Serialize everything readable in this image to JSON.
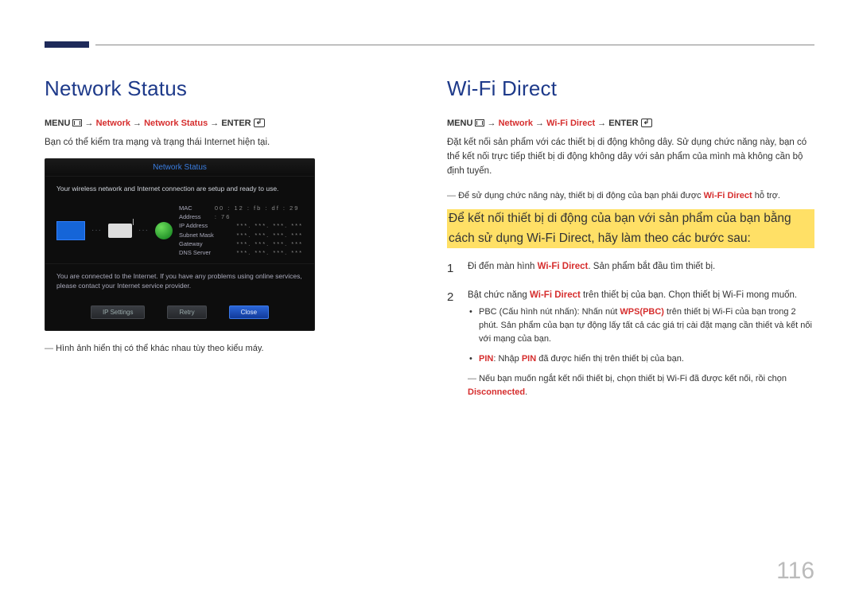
{
  "page_number": "116",
  "left": {
    "heading": "Network Status",
    "menu_prefix": "MENU",
    "menu_seg1": "Network",
    "menu_seg2": "Network Status",
    "menu_suffix": "ENTER",
    "body1": "Bạn có thể kiểm tra mạng và trạng thái Internet hiện tại.",
    "screenshot": {
      "title": "Network Status",
      "line1": "Your wireless network and Internet connection are setup and ready to use.",
      "info": {
        "mac_label": "MAC Address",
        "mac_val": "00 : 12 : fb : df : 29 : 76",
        "ip_label": "IP Address",
        "ip_val": "***.  ***.  ***.  ***",
        "subnet_label": "Subnet Mask",
        "subnet_val": "***.  ***.  ***.  ***",
        "gw_label": "Gateway",
        "gw_val": "***.  ***.  ***.  ***",
        "dns_label": "DNS Server",
        "dns_val": "***.  ***.  ***.  ***"
      },
      "line2": "You are connected to the Internet. If you have any problems using online services, please contact your Internet service provider.",
      "btn_ip": "IP Settings",
      "btn_retry": "Retry",
      "btn_close": "Close"
    },
    "note": "Hình ảnh hiển thị có thể khác nhau tùy theo kiểu máy."
  },
  "right": {
    "heading": "Wi-Fi Direct",
    "menu_prefix": "MENU",
    "menu_seg1": "Network",
    "menu_seg2": "Wi-Fi Direct",
    "menu_suffix": "ENTER",
    "body1": "Đặt kết nối sản phẩm với các thiết bị di động không dây. Sử dụng chức năng này, bạn có thể kết nối trực tiếp thiết bị di động không dây với sản phẩm của mình mà không cần bộ định tuyến.",
    "note1_pre": "Để sử dụng chức năng này, thiết bị di động của bạn phải được ",
    "note1_hl": "Wi-Fi Direct",
    "note1_post": " hỗ trợ.",
    "highlight": "Để kết nối thiết bị di động của bạn với sản phẩm của bạn bằng cách sử dụng  Wi-Fi Direct, hãy làm theo các bước sau:",
    "step1_pre": "Đi đến màn hình ",
    "step1_hl": "Wi-Fi Direct",
    "step1_post": ". Sản phẩm bắt đầu tìm thiết bị.",
    "step2_pre": "Bật chức năng ",
    "step2_hl": "Wi-Fi Direct",
    "step2_post": " trên thiết bị của bạn. Chọn thiết bị Wi-Fi mong muốn.",
    "bullet1_pre": "PBC (Cấu hình nút nhấn): Nhấn nút ",
    "bullet1_hl": "WPS(PBC)",
    "bullet1_post": " trên thiết bị Wi-Fi của bạn trong 2 phút. Sản phẩm của bạn tự động lấy tất cả các giá trị cài đặt mạng cần thiết và kết nối với mạng của bạn.",
    "bullet2_hl1": "PIN",
    "bullet2_mid": ": Nhập ",
    "bullet2_hl2": "PIN",
    "bullet2_post": " đã được hiển thị trên thiết bị của bạn.",
    "note2_pre": "Nếu bạn muốn ngắt kết nối thiết bị, chọn thiết bị Wi-Fi đã được kết nối, rồi chọn ",
    "note2_hl": "Disconnected",
    "note2_post": "."
  }
}
